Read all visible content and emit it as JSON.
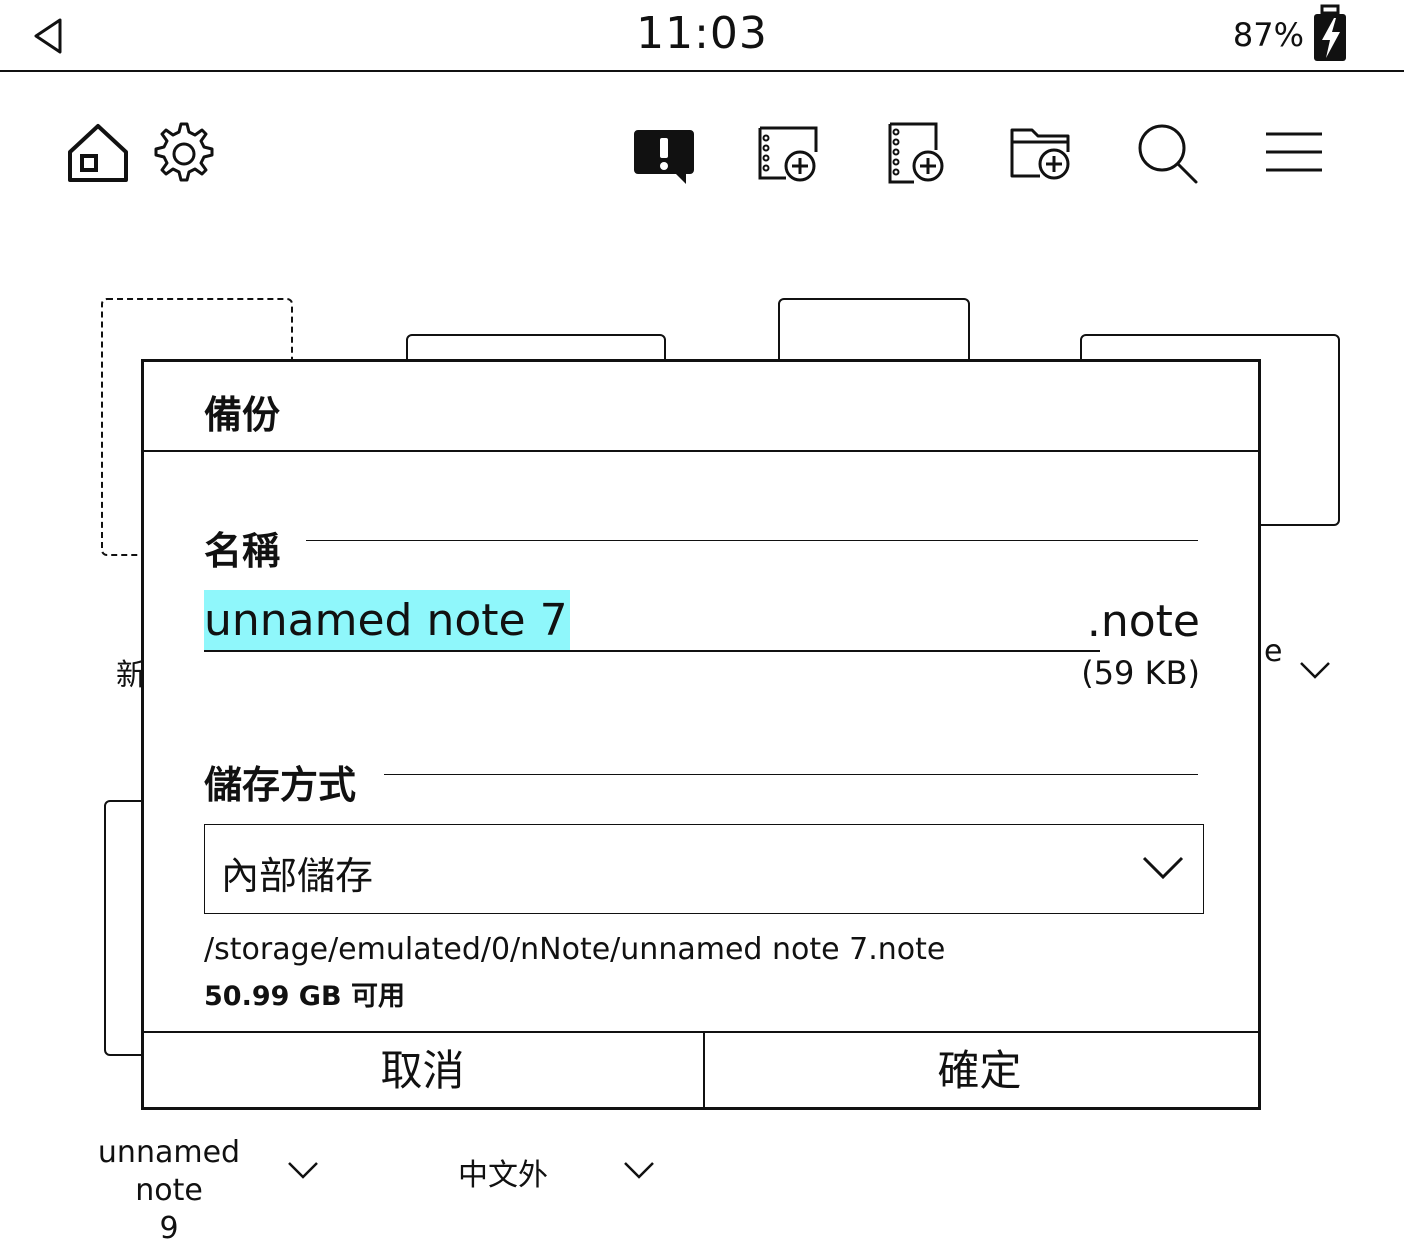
{
  "status_bar": {
    "time": "11:03",
    "battery": "87%"
  },
  "toolbar": {
    "icons": [
      "home-icon",
      "settings-icon",
      "feedback-icon",
      "new-note-icon",
      "new-notebook-icon",
      "new-folder-icon",
      "search-icon",
      "menu-icon"
    ]
  },
  "background": {
    "items": [
      {
        "label": "新",
        "has_menu": false
      },
      {
        "label": "e",
        "has_menu": true
      },
      {
        "label": "unnamed note\n9",
        "has_menu": true
      },
      {
        "label": "中文外",
        "has_menu": true
      }
    ]
  },
  "dialog": {
    "title": "備份",
    "name_section": "名稱",
    "name_value": "unnamed note 7",
    "extension": ".note",
    "size": "(59 KB)",
    "storage_section": "儲存方式",
    "storage_value": "內部儲存",
    "path": "/storage/emulated/0/nNote/unnamed note 7.note",
    "free_space": "50.99 GB 可用",
    "cancel_label": "取消",
    "confirm_label": "確定"
  },
  "colors": {
    "selection": "#8ff7fb",
    "ink": "#111111",
    "background": "#ffffff"
  }
}
